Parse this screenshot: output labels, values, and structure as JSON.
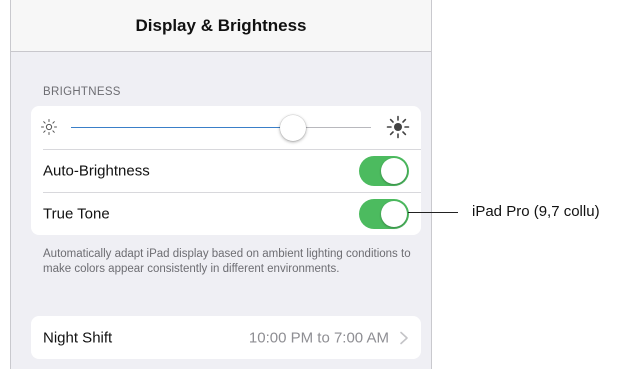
{
  "navbar": {
    "title": "Display & Brightness"
  },
  "brightness": {
    "header": "BRIGHTNESS",
    "level": 0.74,
    "icons": {
      "min": "sun-small-icon",
      "max": "sun-large-icon"
    }
  },
  "auto_brightness": {
    "label": "Auto-Brightness",
    "on": true
  },
  "true_tone": {
    "label": "True Tone",
    "on": true
  },
  "footer_note": "Automatically adapt iPad display based on ambient lighting conditions to make colors appear consistently in different environments.",
  "night_shift": {
    "label": "Night Shift",
    "value": "10:00 PM to 7:00 AM",
    "icon": "chevron-right-icon"
  },
  "callout": {
    "text": "iPad Pro (9,7 collu)"
  },
  "colors": {
    "accent": "#3a7fc8",
    "toggle_on": "#4cbb5f",
    "background": "#efeff4"
  }
}
